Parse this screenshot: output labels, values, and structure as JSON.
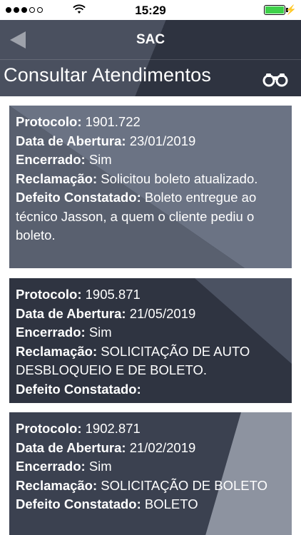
{
  "status_bar": {
    "time": "15:29",
    "signal_dots_filled": 3,
    "signal_dots_total": 5,
    "battery_level": 1.0,
    "icons": [
      "signal-dots-icon",
      "wifi-icon",
      "battery-icon",
      "charging-bolt-icon"
    ]
  },
  "nav": {
    "title": "SAC",
    "back_icon": "back-arrow-icon"
  },
  "page": {
    "title": "Consultar Atendimentos",
    "search_icon": "binoculars-icon"
  },
  "labels": {
    "protocolo": "Protocolo:",
    "data_abertura": "Data de Abertura:",
    "encerrado": "Encerrado:",
    "reclamacao": "Reclamação:",
    "defeito": "Defeito Constatado:"
  },
  "records": [
    {
      "protocolo": "1901.722",
      "data_abertura": "23/01/2019",
      "encerrado": "Sim",
      "reclamacao": "Solicitou boleto atualizado.",
      "defeito": "Boleto entregue ao técnico Jasson, a quem o cliente pediu o boleto."
    },
    {
      "protocolo": "1905.871",
      "data_abertura": "21/05/2019",
      "encerrado": "Sim",
      "reclamacao": "SOLICITAÇÃO DE AUTO DESBLOQUEIO E DE BOLETO.",
      "defeito": ""
    },
    {
      "protocolo": "1902.871",
      "data_abertura": "21/02/2019",
      "encerrado": "Sim",
      "reclamacao": "SOLICITAÇÃO DE BOLETO",
      "defeito": "BOLETO"
    }
  ],
  "colors": {
    "card_dark": "#2f3441",
    "card_light": "#6b7384",
    "header_light": "#4a505f",
    "header_dark": "#2e3340",
    "battery": "#3fd14a"
  }
}
